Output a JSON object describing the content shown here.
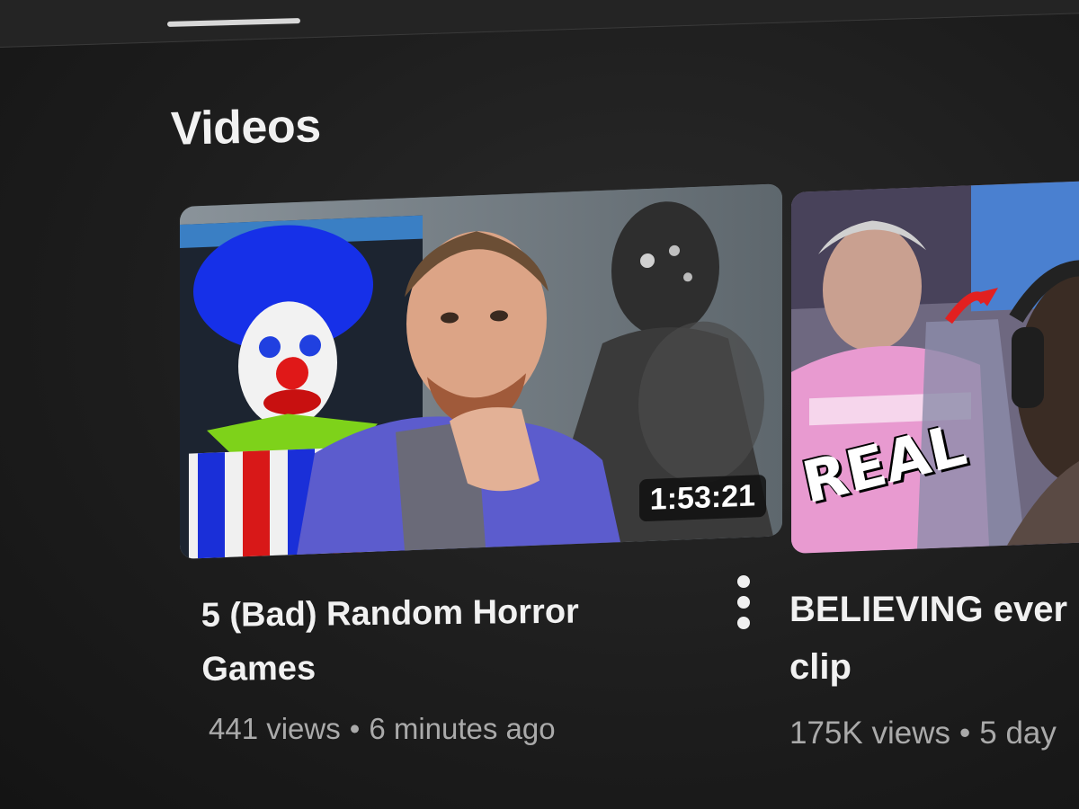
{
  "section": {
    "title": "Videos"
  },
  "videos": [
    {
      "title_line1": "5 (Bad) Random Horror",
      "title_line2": "Games",
      "duration": "1:53:21",
      "views": "441 views",
      "separator": "•",
      "age": "6 minutes ago"
    },
    {
      "title_line1": "BELIEVING ever",
      "title_line2": "clip",
      "thumbnail_text": "REAL",
      "views": "175K views",
      "separator": "•",
      "age": "5 day"
    }
  ],
  "colors": {
    "background": "#1d1d1d",
    "title_text": "#f1f1f1",
    "meta_text": "#aaaaaa"
  }
}
